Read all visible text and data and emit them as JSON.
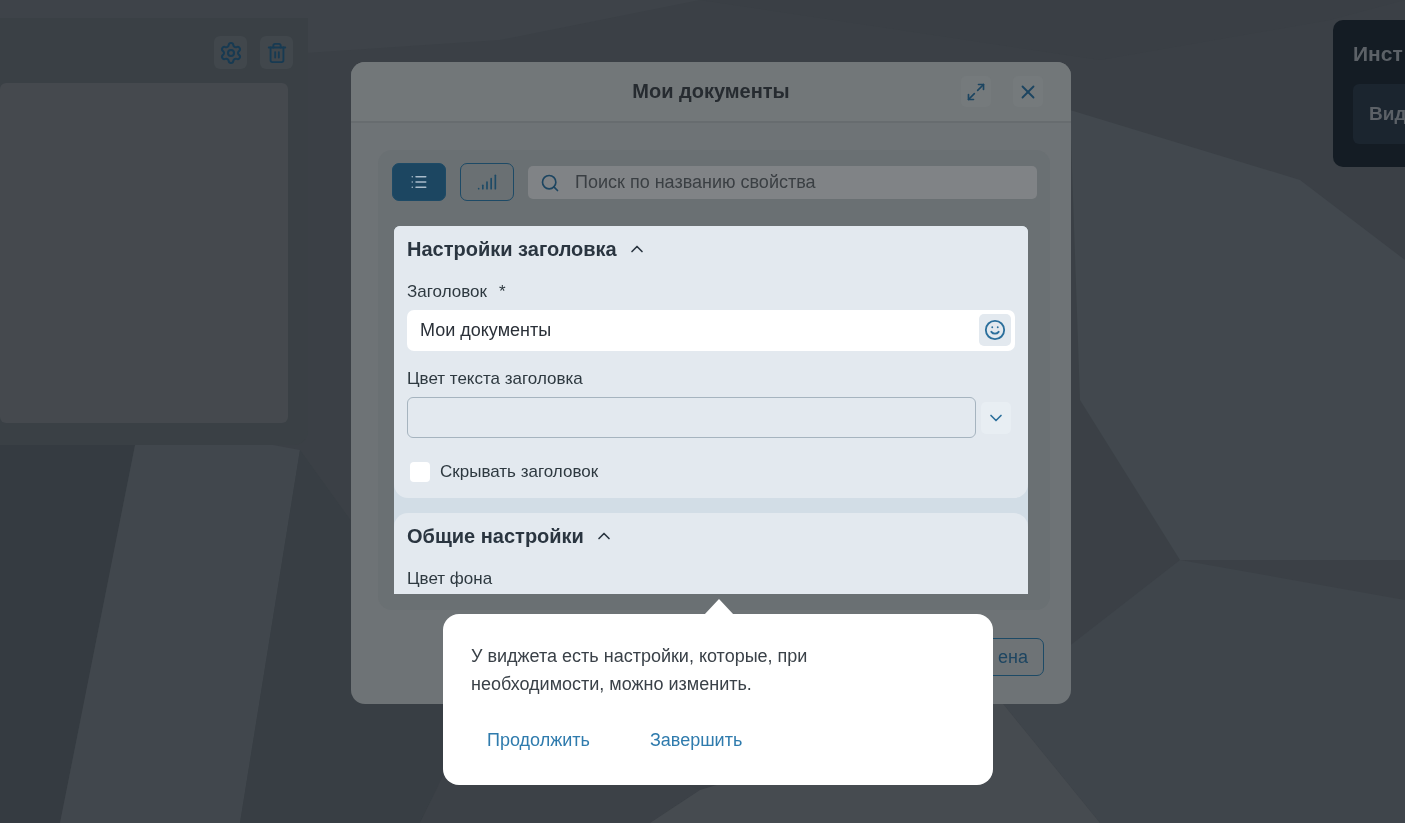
{
  "side_panel": {
    "title": "Инст",
    "button": "Вид"
  },
  "dialog": {
    "title": "Мои документы",
    "view_tabs": [
      {
        "kind": "list",
        "selected": true
      },
      {
        "kind": "chart",
        "selected": false
      }
    ],
    "search": {
      "placeholder": "Поиск по названию свойства"
    },
    "sections": [
      {
        "title": "Настройки заголовка",
        "expanded": true,
        "fields": [
          {
            "kind": "text",
            "label": "Заголовок",
            "required_mark": "*",
            "value": "Мои документы"
          },
          {
            "kind": "select",
            "label": "Цвет текста заголовка"
          },
          {
            "kind": "checkbox",
            "label": "Скрывать заголовок",
            "checked": false
          }
        ]
      },
      {
        "title": "Общие настройки",
        "expanded": true,
        "fields": [
          {
            "kind": "label",
            "label": "Цвет фона"
          }
        ]
      }
    ],
    "footer_button": "ена"
  },
  "tooltip": {
    "text": "У виджета есть настройки, которые, при необходимости, можно изменить.",
    "actions": [
      "Продолжить",
      "Завершить"
    ]
  }
}
